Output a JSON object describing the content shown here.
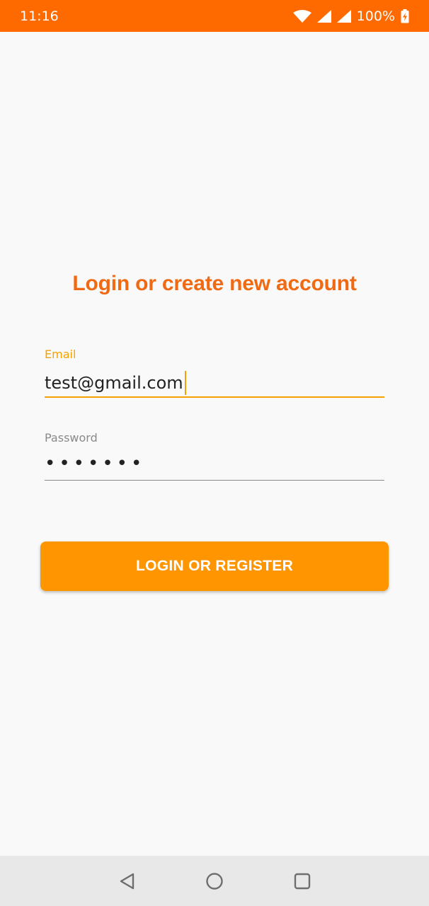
{
  "status_bar": {
    "time": "11:16",
    "battery": "100%",
    "icons": [
      "wifi-icon",
      "signal-icon",
      "signal-icon",
      "battery-charging-icon"
    ],
    "background": "#ff6a00"
  },
  "login": {
    "title": "Login or create new account",
    "email": {
      "label": "Email",
      "value": "test@gmail.com",
      "focused": true
    },
    "password": {
      "label": "Password",
      "value": "•••••••"
    },
    "submit_label": "LOGIN OR REGISTER"
  },
  "nav_bar": {
    "items": [
      "back-icon",
      "home-icon",
      "recent-apps-icon"
    ]
  },
  "colors": {
    "title": "#f06a14",
    "accent": "#f5a200",
    "button": "#ff9500"
  }
}
